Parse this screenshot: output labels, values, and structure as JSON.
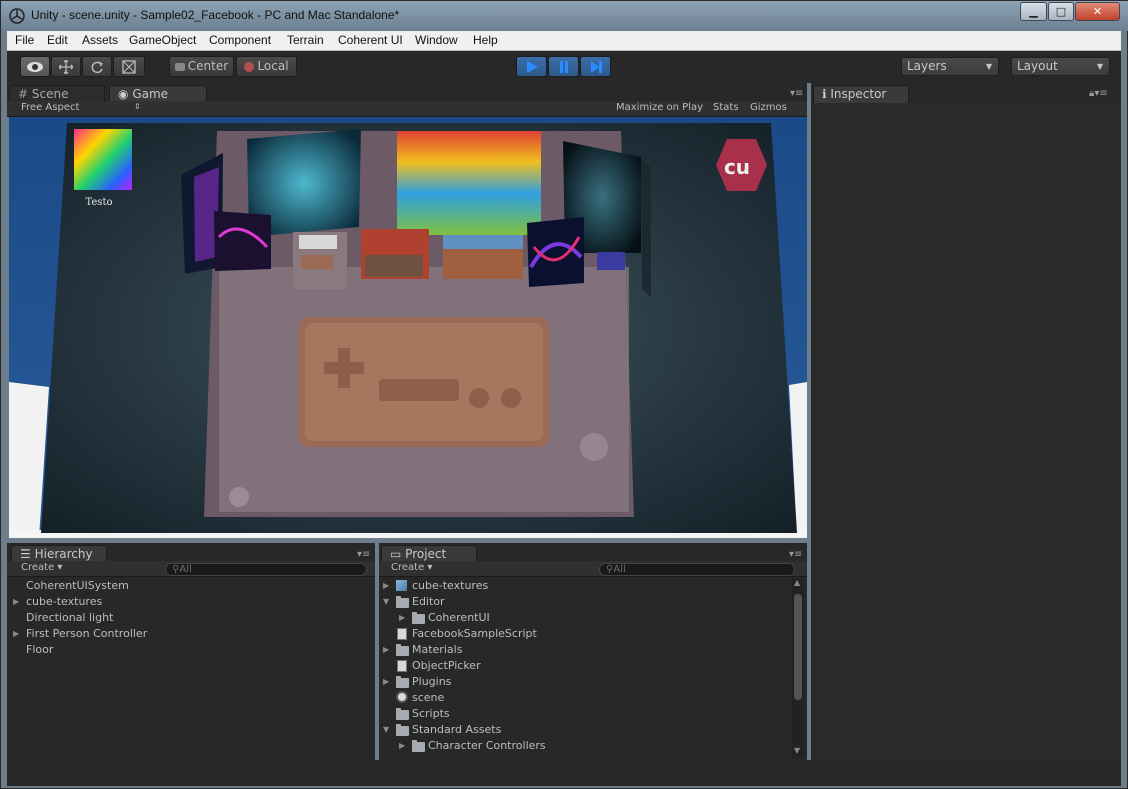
{
  "window": {
    "title": "Unity - scene.unity - Sample02_Facebook - PC and Mac Standalone*",
    "controls": {
      "minimize": "▁",
      "maximize": "□",
      "close": "✕"
    }
  },
  "menu": [
    "File",
    "Edit",
    "Assets",
    "GameObject",
    "Component",
    "Terrain",
    "Coherent UI",
    "Window",
    "Help"
  ],
  "toolbar": {
    "pivot_label": "Center",
    "space_label": "Local",
    "layers_label": "Layers",
    "layout_label": "Layout",
    "icons": {
      "view": "eye-icon",
      "move": "move-icon",
      "rotate": "rotate-icon",
      "scale": "scale-icon",
      "play": "play-icon",
      "pause": "pause-icon",
      "step": "step-icon"
    }
  },
  "scene_panel": {
    "tabs": [
      "Scene",
      "Game"
    ],
    "aspect_label": "Free Aspect",
    "maximize_label": "Maximize on Play",
    "stats_label": "Stats",
    "gizmos_label": "Gizmos",
    "game_overlay": {
      "logo_text": "cu",
      "thumbnail_caption": "Testo"
    }
  },
  "inspector": {
    "tab": "Inspector"
  },
  "hierarchy": {
    "tab": "Hierarchy",
    "create_label": "Create",
    "search_placeholder": "All",
    "items": [
      {
        "label": "CoherentUISystem",
        "expandable": false
      },
      {
        "label": "cube-textures",
        "expandable": true
      },
      {
        "label": "Directional light",
        "expandable": false
      },
      {
        "label": "First Person Controller",
        "expandable": true
      },
      {
        "label": "Floor",
        "expandable": false
      }
    ]
  },
  "project": {
    "tab": "Project",
    "create_label": "Create",
    "search_placeholder": "All",
    "items": [
      {
        "label": "cube-textures",
        "icon": "prefab-icon",
        "indent": 0,
        "arrow": "right"
      },
      {
        "label": "Editor",
        "icon": "folder-icon",
        "indent": 0,
        "arrow": "down"
      },
      {
        "label": "CoherentUI",
        "icon": "folder-icon",
        "indent": 1,
        "arrow": "right"
      },
      {
        "label": "FacebookSampleScript",
        "icon": "script-icon",
        "indent": 0,
        "arrow": ""
      },
      {
        "label": "Materials",
        "icon": "folder-icon",
        "indent": 0,
        "arrow": "right"
      },
      {
        "label": "ObjectPicker",
        "icon": "script-icon",
        "indent": 0,
        "arrow": ""
      },
      {
        "label": "Plugins",
        "icon": "folder-icon",
        "indent": 0,
        "arrow": "right"
      },
      {
        "label": "scene",
        "icon": "scene-icon",
        "indent": 0,
        "arrow": ""
      },
      {
        "label": "Scripts",
        "icon": "folder-icon",
        "indent": 0,
        "arrow": ""
      },
      {
        "label": "Standard Assets",
        "icon": "folder-icon",
        "indent": 0,
        "arrow": "down"
      },
      {
        "label": "Character Controllers",
        "icon": "folder-icon",
        "indent": 1,
        "arrow": "right"
      }
    ]
  },
  "colors": {
    "play_accent": "#3c6ea8",
    "panel_bg": "#1e1e1e",
    "game_sky": "#1f4f8d"
  }
}
